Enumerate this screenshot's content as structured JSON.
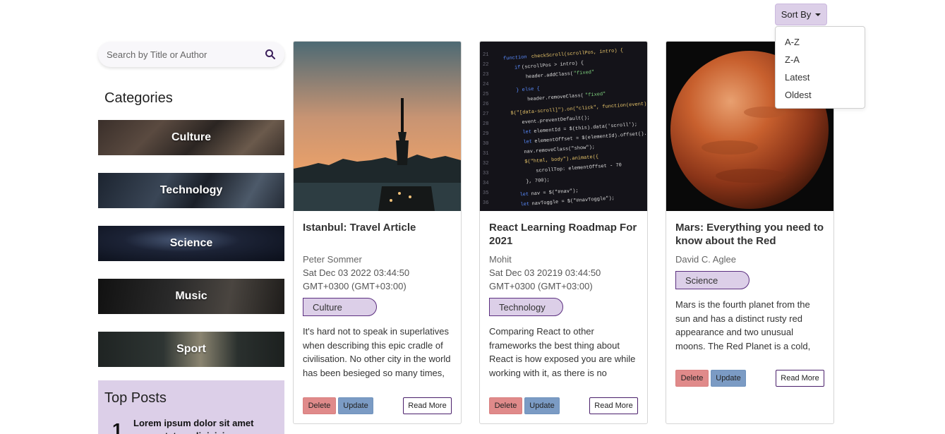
{
  "sort": {
    "label": "Sort By",
    "options": [
      "A-Z",
      "Z-A",
      "Latest",
      "Oldest"
    ]
  },
  "search": {
    "placeholder": "Search by Title or Author"
  },
  "categories": {
    "title": "Categories",
    "items": [
      "Culture",
      "Technology",
      "Science",
      "Music",
      "Sport"
    ]
  },
  "top_posts": {
    "title": "Top Posts",
    "items": [
      {
        "rank": "1",
        "title": "Lorem ipsum dolor sit amet consectetur adipisicing"
      }
    ]
  },
  "posts": [
    {
      "title": "Istanbul: Travel Article",
      "author": "Peter Sommer",
      "date": "Sat Dec 03 2022 03:44:50 GMT+0300 (GMT+03:00)",
      "category": "Culture",
      "excerpt": "It's hard not to speak in superlatives when describing this epic cradle of civilisation. No other city in the world has been besieged so many times, so",
      "delete_label": "Delete",
      "update_label": "Update",
      "read_more_label": "Read More"
    },
    {
      "title": "React Learning Roadmap For 2021",
      "author": "Mohit",
      "date": "Sat Dec 03 20219 03:44:50 GMT+0300 (GMT+03:00)",
      "category": "Technology",
      "excerpt": "Comparing React to other frameworks the best thing about React is how exposed you are while working with it, as there is no",
      "delete_label": "Delete",
      "update_label": "Update",
      "read_more_label": "Read More"
    },
    {
      "title": "Mars: Everything you need to know about the Red",
      "author": "David C. Aglee",
      "date": "",
      "category": "Science",
      "excerpt": "Mars is the fourth planet from the sun and has a distinct rusty red appearance and two unusual moons. The Red Planet is a cold, desert world",
      "delete_label": "Delete",
      "update_label": "Update",
      "read_more_label": "Read More"
    }
  ],
  "colors": {
    "accent": "#dccfe8",
    "accent_border": "#5b2f7f",
    "delete": "#e08a8a",
    "update": "#7b9bc4"
  }
}
